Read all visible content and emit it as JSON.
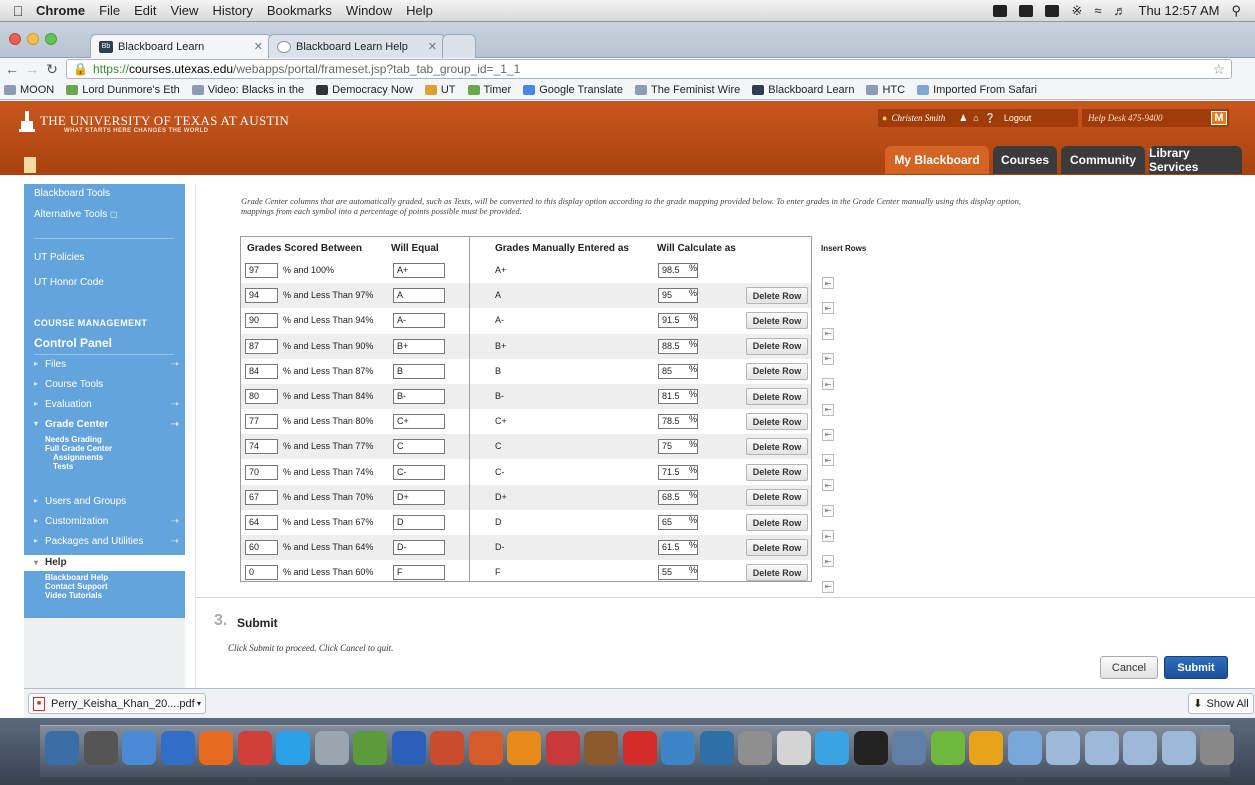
{
  "menubar": {
    "app": "Chrome",
    "menus": [
      "File",
      "Edit",
      "View",
      "History",
      "Bookmarks",
      "Window",
      "Help"
    ],
    "clock": "Thu 12:57 AM"
  },
  "tabs": [
    {
      "label": "Blackboard Learn",
      "icon": "blackboard-icon"
    },
    {
      "label": "Blackboard Learn Help",
      "icon": "help-icon"
    }
  ],
  "url": {
    "scheme": "https://",
    "host": "courses.utexas.edu",
    "path": "/webapps/portal/frameset.jsp?tab_tab_group_id=_1_1"
  },
  "bookmarks": [
    {
      "label": "MOON",
      "color": "#8a9db4"
    },
    {
      "label": "Lord Dunmore's Eth",
      "color": "#6aa84f"
    },
    {
      "label": "Video: Blacks in the",
      "color": "#8a9db4"
    },
    {
      "label": "Democracy Now",
      "color": "#333333"
    },
    {
      "label": "UT",
      "color": "#e0a030"
    },
    {
      "label": "Timer",
      "color": "#6aa84f"
    },
    {
      "label": "Google Translate",
      "color": "#4a86e8"
    },
    {
      "label": "The Feminist Wire",
      "color": "#8a9db4"
    },
    {
      "label": "Blackboard Learn",
      "color": "#2c3e50"
    },
    {
      "label": "HTC",
      "color": "#8a9db4"
    },
    {
      "label": "Imported From Safari",
      "color": "#7fa7d6"
    }
  ],
  "banner": {
    "university": "THE UNIVERSITY OF TEXAS AT AUSTIN",
    "tagline": "WHAT STARTS HERE CHANGES THE WORLD",
    "user": "Christen Smith",
    "logout": "Logout",
    "helpdesk": "Help Desk 475-9400",
    "badge": "M"
  },
  "navtabs": [
    {
      "label": "My Blackboard",
      "active": true
    },
    {
      "label": "Courses",
      "active": false
    },
    {
      "label": "Community",
      "active": false
    },
    {
      "label": "Library Services",
      "active": false
    }
  ],
  "sidebar": {
    "blackboard_tools": "Blackboard Tools",
    "alternative_tools": "Alternative Tools",
    "ut_policies": "UT Policies",
    "ut_honor_code": "UT Honor Code",
    "course_management": "COURSE MANAGEMENT",
    "control_panel": "Control Panel",
    "files": "Files",
    "course_tools": "Course Tools",
    "evaluation": "Evaluation",
    "grade_center": "Grade Center",
    "needs_grading": "Needs Grading",
    "full_grade_center": "Full Grade Center",
    "assignments": "Assignments",
    "tests": "Tests",
    "users_and_groups": "Users and Groups",
    "customization": "Customization",
    "packages_and_utilities": "Packages and Utilities",
    "help": "Help",
    "blackboard_help": "Blackboard Help",
    "contact_support": "Contact Support",
    "video_tutorials": "Video Tutorials"
  },
  "intro_line1": "Grade Center columns that are automatically graded, such as Tests, will be converted to this display option according to the grade mapping provided below. To enter grades in the Grade Center manually using this display option,",
  "intro_line2": "mappings from each symbol into a percentage of points possible must be provided.",
  "table": {
    "headers": {
      "scored_between": "Grades Scored Between",
      "will_equal": "Will Equal",
      "manually_entered": "Grades Manually Entered as",
      "will_calculate": "Will Calculate as",
      "insert_rows": "Insert Rows"
    },
    "delete_label": "Delete Row",
    "rows": [
      {
        "low": "97",
        "range": "% and  100%",
        "equal": "A+",
        "manual": "A+",
        "calc": "98.5"
      },
      {
        "low": "94",
        "range": "% and  Less Than  97%",
        "equal": "A",
        "manual": "A",
        "calc": "95"
      },
      {
        "low": "90",
        "range": "% and  Less Than  94%",
        "equal": "A-",
        "manual": "A-",
        "calc": "91.5"
      },
      {
        "low": "87",
        "range": "% and  Less Than  90%",
        "equal": "B+",
        "manual": "B+",
        "calc": "88.5"
      },
      {
        "low": "84",
        "range": "% and  Less Than  87%",
        "equal": "B",
        "manual": "B",
        "calc": "85"
      },
      {
        "low": "80",
        "range": "% and  Less Than  84%",
        "equal": "B-",
        "manual": "B-",
        "calc": "81.5"
      },
      {
        "low": "77",
        "range": "% and  Less Than  80%",
        "equal": "C+",
        "manual": "C+",
        "calc": "78.5"
      },
      {
        "low": "74",
        "range": "% and  Less Than  77%",
        "equal": "C",
        "manual": "C",
        "calc": "75"
      },
      {
        "low": "70",
        "range": "% and  Less Than  74%",
        "equal": "C-",
        "manual": "C-",
        "calc": "71.5"
      },
      {
        "low": "67",
        "range": "% and  Less Than  70%",
        "equal": "D+",
        "manual": "D+",
        "calc": "68.5"
      },
      {
        "low": "64",
        "range": "% and  Less Than  67%",
        "equal": "D",
        "manual": "D",
        "calc": "65"
      },
      {
        "low": "60",
        "range": "% and  Less Than  64%",
        "equal": "D-",
        "manual": "D-",
        "calc": "61.5"
      },
      {
        "low": "0",
        "range": "% and  Less Than  60%",
        "equal": "F",
        "manual": "F",
        "calc": "55"
      }
    ],
    "percent": "%"
  },
  "submit": {
    "step": "3.",
    "title": "Submit",
    "text": "Click Submit to proceed. Click Cancel to quit.",
    "cancel": "Cancel",
    "submit": "Submit"
  },
  "downloads": {
    "file": "Perry_Keisha_Khan_20....pdf",
    "show_all": "Show All"
  }
}
